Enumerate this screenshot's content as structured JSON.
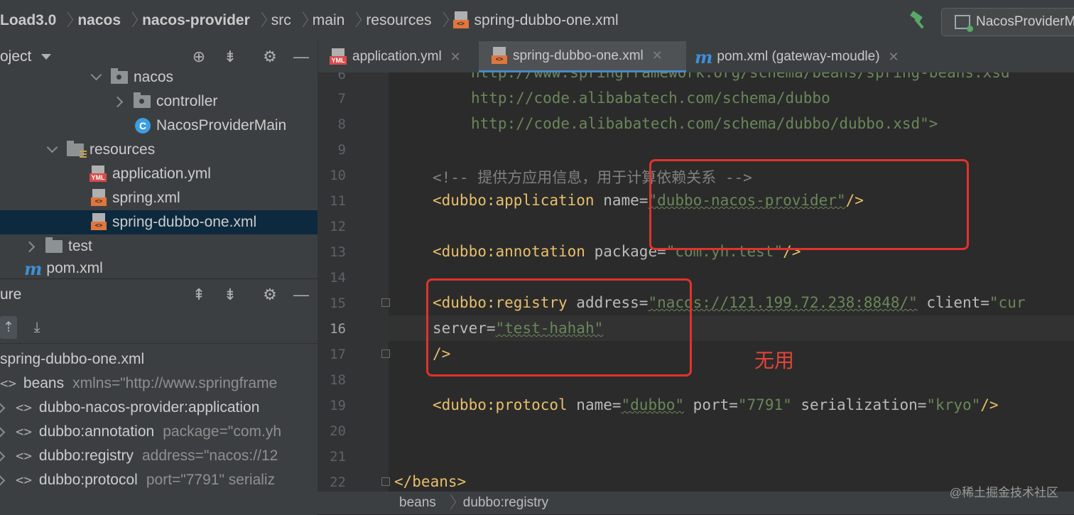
{
  "breadcrumb": [
    "Load3.0",
    "nacos",
    "nacos-provider",
    "src",
    "main",
    "resources",
    "spring-dubbo-one.xml"
  ],
  "file_tag": "<>",
  "run_config": "NacosProviderM",
  "project_panel": {
    "title": "oject",
    "tree": [
      {
        "label": "nacos",
        "icon": "package-folder-icon"
      },
      {
        "label": "controller",
        "icon": "package-folder-icon"
      },
      {
        "label": "NacosProviderMain",
        "icon": "class-icon",
        "badge": "C"
      },
      {
        "label": "resources",
        "icon": "resources-folder-icon"
      },
      {
        "label": "application.yml",
        "icon": "yml-file-icon",
        "badge": "YML"
      },
      {
        "label": "spring.xml",
        "icon": "xml-file-icon"
      },
      {
        "label": "spring-dubbo-one.xml",
        "icon": "xml-file-icon",
        "selected": true
      },
      {
        "label": "test",
        "icon": "folder-icon"
      },
      {
        "label": "pom.xml",
        "icon": "maven-icon",
        "badge": "m"
      }
    ]
  },
  "structure_panel": {
    "title": "ure",
    "file": "spring-dubbo-one.xml",
    "bracket": "<>",
    "rows": [
      {
        "label": "beans",
        "attr": "xmlns=\"http://www.springframe"
      },
      {
        "label": "dubbo-nacos-provider:application",
        "attr": ""
      },
      {
        "label": "dubbo:annotation",
        "attr": "package=\"com.yh"
      },
      {
        "label": "dubbo:registry",
        "attr": "address=\"nacos://12"
      },
      {
        "label": "dubbo:protocol",
        "attr": "port=\"7791\" serializ"
      }
    ]
  },
  "tabs": [
    {
      "label": "application.yml",
      "active": false
    },
    {
      "label": "spring-dubbo-one.xml",
      "active": true
    },
    {
      "label": "pom.xml (gateway-moudle)",
      "active": false
    }
  ],
  "editor": {
    "line_numbers": [
      "6",
      "7",
      "8",
      "9",
      "10",
      "11",
      "12",
      "13",
      "14",
      "15",
      "16",
      "17",
      "18",
      "19",
      "20",
      "21",
      "22"
    ],
    "current_line": "16",
    "lines": {
      "l6": "http://www.springframework.org/schema/beans/spring-beans.xsd",
      "l7": "http://code.alibabatech.com/schema/dubbo",
      "l8": "http://code.alibabatech.com/schema/dubbo/dubbo.xsd\">",
      "l10": "<!-- 提供方应用信息，用于计算依赖关系 -->",
      "l11_ns": "<dubbo",
      "l11_tag": ":application",
      "l11_attr": " name=",
      "l11_val": "\"dubbo-nacos-provider\"",
      "l11_end": "/>",
      "l13_ns": "<dubbo",
      "l13_tag": ":annotation",
      "l13_attr": " package=",
      "l13_val": "\"com.yh.test\"",
      "l13_end": "/>",
      "l15_ns": "<dubbo",
      "l15_tag": ":registry",
      "l15_attr": " address=",
      "l15_val": "\"nacos://121.199.72.238:8848/\"",
      "l15_attr2": " client=",
      "l15_val2": "\"cur",
      "l16_attr": "server=",
      "l16_val": "\"test-hahah\"",
      "l17": "/>",
      "l19_ns": "<dubbo",
      "l19_tag": ":protocol",
      "l19_attr": " name=",
      "l19_val": "\"dubbo\"",
      "l19_attr2": " port=",
      "l19_val2": "\"7791\"",
      "l19_attr3": " serialization=",
      "l19_val3": "\"kryo\"",
      "l19_end": "/>",
      "l22": "</beans>"
    },
    "annotation_note": "无用"
  },
  "footer_crumbs": [
    "beans",
    "dubbo:registry"
  ],
  "watermark": "@稀土掘金技术社区",
  "colors": {
    "annotation_red": "#e0332b",
    "selection": "#0d293e",
    "tab_underline": "#4a88c7"
  }
}
